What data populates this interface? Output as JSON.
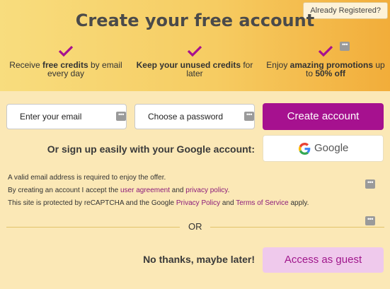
{
  "header": {
    "already_registered": "Already Registered?",
    "title": "Create your free account",
    "benefits": [
      {
        "pre": "Receive ",
        "bold": "free credits",
        "post": " by email every day"
      },
      {
        "pre": "",
        "bold": "Keep your unused credits",
        "post": " for later"
      },
      {
        "pre": "Enjoy ",
        "bold": "amazing promotions",
        "post": " up to ",
        "bold2": "50% off"
      }
    ]
  },
  "form": {
    "email_placeholder": "Enter your email",
    "password_placeholder": "Choose a password",
    "create_button": "Create account",
    "google_prompt": "Or sign up easily with your Google account:",
    "google_button": "Google"
  },
  "notes": {
    "line1": "A valid email address is required to enjoy the offer.",
    "line2_pre": "By creating an account I accept the ",
    "line2_link1": "user agreement",
    "line2_mid": " and ",
    "line2_link2": "privacy policy",
    "line2_post": ".",
    "line3_pre": "This site is protected by reCAPTCHA and the Google ",
    "line3_link1": "Privacy Policy",
    "line3_mid": " and ",
    "line3_link2": "Terms of Service",
    "line3_post": " apply."
  },
  "divider": {
    "or": "OR"
  },
  "guest": {
    "prompt": "No thanks, maybe later!",
    "button": "Access as guest"
  },
  "colors": {
    "accent": "#a6118f",
    "guest_bg": "#efc9ec",
    "panel_bg": "#fbe8b6"
  },
  "icons": {
    "check": "check-icon",
    "more": "more-dots-icon",
    "google": "google-g-icon"
  }
}
